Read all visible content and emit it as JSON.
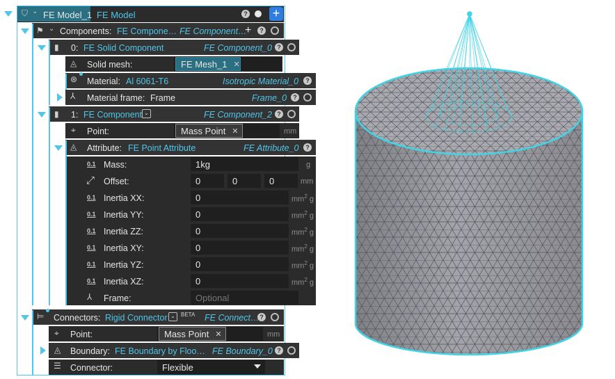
{
  "model": {
    "title": "FE Model_1",
    "type": "FE Model",
    "add_button": "+"
  },
  "components": {
    "label": "Components:",
    "value": "FE Compone…",
    "type": "FE Component…",
    "add": "+"
  },
  "solid": {
    "index": "0:",
    "name": "FE Solid Component",
    "type": "FE Component_0",
    "mesh_label": "Solid mesh:",
    "mesh_value": "FE Mesh_1",
    "material_label": "Material:",
    "material_value": "Al 6061-T6",
    "material_type": "Isotropic Material_0",
    "frame_label": "Material frame:",
    "frame_value": "Frame",
    "frame_type": "Frame_0"
  },
  "fe_component": {
    "index": "1:",
    "name": "FE Component",
    "type": "FE Component_2",
    "point_label": "Point:",
    "point_value": "Mass Point",
    "point_unit": "mm",
    "attribute_label": "Attribute:",
    "attribute_value": "FE Point Attribute",
    "attribute_type": "FE Attribute_0"
  },
  "attr_icon": "0.1",
  "mass": {
    "label": "Mass:",
    "value": "1kg",
    "unit": "g"
  },
  "offset": {
    "label": "Offset:",
    "x": "0",
    "y": "0",
    "z": "0",
    "unit": "mm"
  },
  "inertia": [
    {
      "label": "Inertia XX:",
      "value": "0"
    },
    {
      "label": "Inertia YY:",
      "value": "0"
    },
    {
      "label": "Inertia ZZ:",
      "value": "0"
    },
    {
      "label": "Inertia XY:",
      "value": "0"
    },
    {
      "label": "Inertia YZ:",
      "value": "0"
    },
    {
      "label": "Inertia XZ:",
      "value": "0"
    }
  ],
  "inertia_unit_base": "mm",
  "inertia_unit_sup": "2",
  "inertia_unit_tail": " g",
  "frame": {
    "label": "Frame:",
    "placeholder": "Optional"
  },
  "connectors": {
    "label": "Connectors:",
    "value": "Rigid Connector",
    "badge": "BETA",
    "type": "FE Connect…",
    "point_label": "Point:",
    "point_value": "Mass Point",
    "point_unit": "mm",
    "boundary_label": "Boundary:",
    "boundary_value": "FE Boundary by Floo…",
    "boundary_type": "FE Boundary_0",
    "connector_label": "Connector:",
    "connector_value": "Flexible"
  },
  "help": "?",
  "remove": "✕",
  "colors": {
    "accent": "#4fc6ea",
    "panel": "#2b2b2b",
    "row": "#333333",
    "mesh_fill": "#9a9aa0",
    "edge": "#3fd4e6"
  }
}
